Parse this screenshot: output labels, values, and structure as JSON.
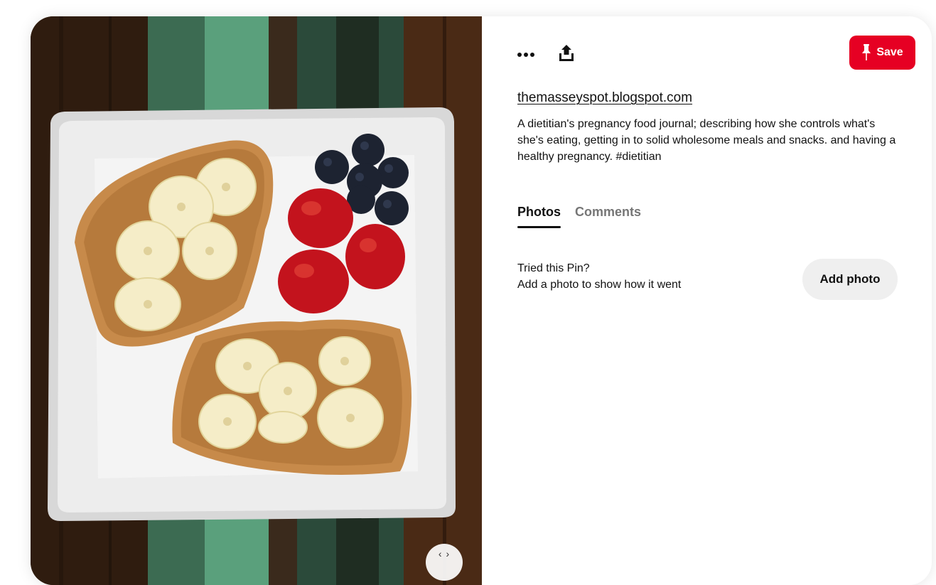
{
  "pin": {
    "image_alt": "Peanut butter toast with banana slices, strawberries and blueberries on a white square plate",
    "expand_label": "‹ ›"
  },
  "toolbar": {
    "more_icon": "more-dots-icon",
    "share_icon": "share-upload-icon",
    "save_icon": "pin-icon",
    "save_label": "Save"
  },
  "details": {
    "source": "themasseyspot.blogspot.com",
    "description": "A dietitian's pregnancy food journal; describing how she controls what's she's eating, getting in to solid wholesome meals and snacks. and having a healthy pregnancy. #dietitian"
  },
  "tabs": [
    {
      "label": "Photos",
      "active": true
    },
    {
      "label": "Comments",
      "active": false
    }
  ],
  "tried": {
    "line1": "Tried this Pin?",
    "line2": "Add a photo to show how it went",
    "button_label": "Add photo"
  },
  "colors": {
    "save_red": "#e60023",
    "button_gray": "#efefef",
    "inactive_tab": "#767676"
  }
}
